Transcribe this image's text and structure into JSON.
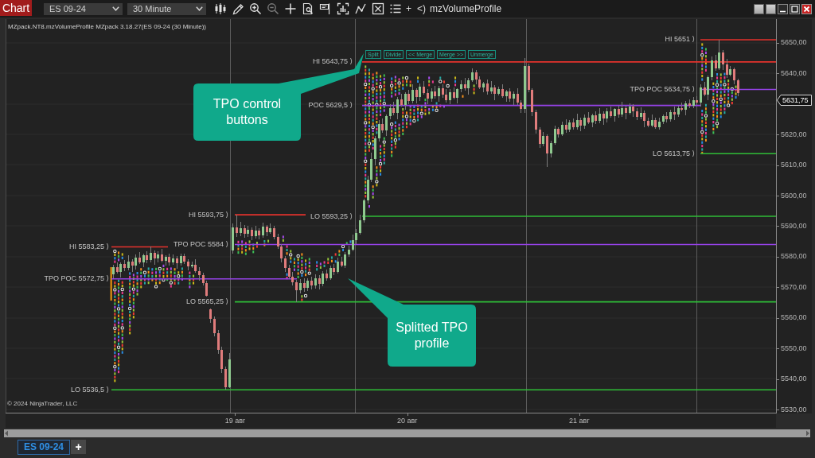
{
  "toolbar": {
    "title": "Chart",
    "instrument": "ES 09-24",
    "interval": "30 Minute",
    "glyphs": [
      "+",
      "<)"
    ],
    "indicator": "mzVolumeProfile"
  },
  "chart": {
    "indicator_label": "MZpack.NT8.mzVolumeProfile MZpack 3.18.27(ES 09-24 (30 Minute))",
    "tpo_buttons": [
      "Split",
      "Divide",
      "<< Merge",
      "Merge >>",
      "Unmerge"
    ],
    "callouts": [
      "TPO control buttons",
      "Splitted TPO profile"
    ],
    "copyright": "© 2024 NinjaTrader, LLC",
    "current_price": "5631,75",
    "chart_data": {
      "type": "candlestick",
      "xlim": [
        17.6656,
        22.143
      ],
      "ylim": [
        5528.75,
        5657.75
      ],
      "yticks": [
        {
          "value": 5650,
          "label": "5650,00"
        },
        {
          "value": 5640,
          "label": "5640,00"
        },
        {
          "value": 5620,
          "label": "5620,00"
        },
        {
          "value": 5610,
          "label": "5610,00"
        },
        {
          "value": 5600,
          "label": "5600,00"
        },
        {
          "value": 5590,
          "label": "5590,00"
        },
        {
          "value": 5580,
          "label": "5580,00"
        },
        {
          "value": 5570,
          "label": "5570,00"
        },
        {
          "value": 5560,
          "label": "5560,00"
        },
        {
          "value": 5550,
          "label": "5550,00"
        },
        {
          "value": 5540,
          "label": "5540,00"
        },
        {
          "value": 5530,
          "label": "5530,00"
        }
      ],
      "xticks": [
        {
          "value": 19,
          "label": "19 авг"
        },
        {
          "value": 20,
          "label": "20 авг"
        },
        {
          "value": 21,
          "label": "21 авг"
        }
      ],
      "ref_lines": [
        {
          "axis": "y",
          "value": 5651,
          "color": "#e5322d",
          "label": "HI 5651 ⟩"
        },
        {
          "axis": "y",
          "value": 5643.75,
          "color": "#e5322d",
          "label": "HI 5643,75 ⟩"
        },
        {
          "axis": "y",
          "value": 5634.75,
          "color": "#9642e8",
          "label": "TPO POC 5634,75 ⟩"
        },
        {
          "axis": "y",
          "value": 5629.5,
          "color": "#9642e8",
          "label": "POC 5629,5 ⟩"
        },
        {
          "axis": "y",
          "value": 5613.75,
          "color": "#2fbd37",
          "label": "LO 5613,75 ⟩"
        },
        {
          "axis": "y",
          "value": 5593.75,
          "color": "#e5322d",
          "label": "HI 5593,75 ⟩"
        },
        {
          "axis": "y",
          "value": 5593.25,
          "color": "#2fbd37",
          "label": "LO 5593,25 ⟩"
        },
        {
          "axis": "y",
          "value": 5583.25,
          "color": "#e5322d",
          "label": "HI 5583,25 ⟩"
        },
        {
          "axis": "y",
          "value": 5584,
          "color": "#9642e8",
          "label": "TPO POC 5584 ⟩"
        },
        {
          "axis": "y",
          "value": 5572.75,
          "color": "#9642e8",
          "label": "TPO POC 5572,75 ⟩"
        },
        {
          "axis": "y",
          "value": 5565.25,
          "color": "#2fbd37",
          "label": "LO 5565,25 ⟩"
        },
        {
          "axis": "y",
          "value": 5536.5,
          "color": "#2fbd37",
          "label": "LO 5536,5 ⟩"
        }
      ],
      "x": [
        18.29,
        18.312,
        18.333,
        18.355,
        18.377,
        18.399,
        18.42,
        18.442,
        18.464,
        18.486,
        18.507,
        18.529,
        18.551,
        18.573,
        18.594,
        18.616,
        18.638,
        18.66,
        18.681,
        18.703,
        18.725,
        18.747,
        18.768,
        18.79,
        18.812,
        18.833,
        18.855,
        18.877,
        18.899,
        18.92,
        18.942,
        18.964,
        18.986,
        19.007,
        19.029,
        19.051,
        19.073,
        19.094,
        19.116,
        19.138,
        19.16,
        19.181,
        19.203,
        19.225,
        19.247,
        19.268,
        19.29,
        19.312,
        19.333,
        19.355,
        19.377,
        19.399,
        19.42,
        19.442,
        19.464,
        19.486,
        19.507,
        19.529,
        19.551,
        19.573,
        19.594,
        19.616,
        19.638,
        19.66,
        19.681,
        19.703,
        19.725,
        19.747,
        19.768,
        19.79,
        19.812,
        19.833,
        19.855,
        19.877,
        19.899,
        19.92,
        19.942,
        19.964,
        19.986,
        20.007,
        20.029,
        20.051,
        20.073,
        20.094,
        20.116,
        20.138,
        20.16,
        20.181,
        20.203,
        20.225,
        20.247,
        20.268,
        20.29,
        20.312,
        20.333,
        20.355,
        20.377,
        20.399,
        20.42,
        20.442,
        20.464,
        20.486,
        20.507,
        20.529,
        20.551,
        20.573,
        20.594,
        20.616,
        20.638,
        20.66,
        20.681,
        20.703,
        20.725,
        20.747,
        20.768,
        20.79,
        20.812,
        20.833,
        20.855,
        20.877,
        20.899,
        20.92,
        20.942,
        20.964,
        20.986,
        21.007,
        21.029,
        21.051,
        21.073,
        21.094,
        21.116,
        21.138,
        21.16,
        21.181,
        21.203,
        21.225,
        21.247,
        21.268,
        21.29,
        21.312,
        21.333,
        21.355,
        21.377,
        21.399,
        21.42,
        21.442,
        21.464,
        21.486,
        21.507,
        21.529,
        21.551,
        21.573,
        21.594,
        21.616,
        21.638,
        21.66,
        21.681,
        21.703,
        21.725,
        21.747,
        21.768,
        21.79,
        21.812,
        21.833,
        21.855,
        21.877,
        21.899,
        21.92
      ],
      "ohlc": [
        [
          5574.25,
          5577.5,
          5573,
          5576.5
        ],
        [
          5576.5,
          5578.25,
          5574.5,
          5575
        ],
        [
          5575,
          5578.25,
          5573.25,
          5577.75
        ],
        [
          5577.75,
          5579,
          5575.25,
          5576.25
        ],
        [
          5576.25,
          5580.5,
          5575.5,
          5578.5
        ],
        [
          5578.5,
          5579.25,
          5575,
          5577
        ],
        [
          5577,
          5580.75,
          5575.75,
          5579.75
        ],
        [
          5579.75,
          5581.5,
          5577.75,
          5578.25
        ],
        [
          5578.25,
          5581,
          5576.5,
          5580.5
        ],
        [
          5580.5,
          5581.75,
          5578,
          5579
        ],
        [
          5579,
          5583.25,
          5578.25,
          5581.25
        ],
        [
          5581.25,
          5582,
          5577.5,
          5579.5
        ],
        [
          5579.5,
          5581.75,
          5578.25,
          5580.75
        ],
        [
          5580.75,
          5582.5,
          5578.25,
          5578.75
        ],
        [
          5578.75,
          5580.5,
          5577,
          5580
        ],
        [
          5580,
          5581,
          5577.25,
          5578.25
        ],
        [
          5578.25,
          5580.75,
          5577.5,
          5579.5
        ],
        [
          5579.5,
          5580.25,
          5576,
          5578
        ],
        [
          5578,
          5581,
          5577.25,
          5580.25
        ],
        [
          5580.25,
          5581,
          5577.75,
          5578.5
        ],
        [
          5578.5,
          5579.25,
          5575.5,
          5576.75
        ],
        [
          5576.75,
          5578.5,
          5576.25,
          5577.5
        ],
        [
          5577.5,
          5579.25,
          5574.75,
          5575.25
        ],
        [
          5575.25,
          5576.5,
          5572.25,
          5574
        ],
        [
          5574,
          5574.75,
          5570.5,
          5571.5
        ],
        [
          5571.5,
          5572.25,
          5567,
          5567.25
        ],
        [
          5562.75,
          5563,
          5558.5,
          5559.75
        ],
        [
          5559.75,
          5560.5,
          5554,
          5555
        ],
        [
          5555,
          5556,
          5548.25,
          5549.5
        ],
        [
          5549.5,
          5550.5,
          5542,
          5543.25
        ],
        [
          5543.25,
          5544,
          5536.5,
          5537.25
        ],
        [
          5537.25,
          5548.5,
          5537,
          5546.5
        ],
        [
          5582,
          5591,
          5581,
          5589.5
        ],
        [
          5589.5,
          5593.75,
          5586.5,
          5587.75
        ],
        [
          5587.75,
          5591.5,
          5586.75,
          5589.25
        ],
        [
          5589.25,
          5590.5,
          5586.25,
          5587.5
        ],
        [
          5587.5,
          5590.25,
          5586.5,
          5588.75
        ],
        [
          5588.75,
          5589.5,
          5585.5,
          5586.75
        ],
        [
          5586.75,
          5590,
          5586,
          5588.5
        ],
        [
          5588.5,
          5589.25,
          5585.75,
          5587
        ],
        [
          5587,
          5591.25,
          5586.25,
          5589.75
        ],
        [
          5589.75,
          5590.5,
          5586.75,
          5588
        ],
        [
          5588,
          5591,
          5587.5,
          5589.25
        ],
        [
          5589.25,
          5590,
          5585.75,
          5586.5
        ],
        [
          5586.5,
          5587.5,
          5582.5,
          5583.25
        ],
        [
          5583.25,
          5584.25,
          5578.25,
          5579.5
        ],
        [
          5579.5,
          5580.25,
          5575,
          5576.25
        ],
        [
          5576.25,
          5577.5,
          5572.75,
          5573.5
        ],
        [
          5573.5,
          5575,
          5570.5,
          5571.75
        ],
        [
          5571.75,
          5572.5,
          5565.25,
          5569
        ],
        [
          5569,
          5572.75,
          5568,
          5571.5
        ],
        [
          5571.5,
          5573,
          5568.5,
          5569.75
        ],
        [
          5569.75,
          5573,
          5568.75,
          5572.25
        ],
        [
          5572.25,
          5573.5,
          5569.25,
          5570.5
        ],
        [
          5570.5,
          5574.25,
          5569.5,
          5573
        ],
        [
          5573,
          5574,
          5569.25,
          5571.25
        ],
        [
          5571.25,
          5575.25,
          5570.25,
          5574.5
        ],
        [
          5574.5,
          5575.75,
          5572.25,
          5573
        ],
        [
          5573,
          5577,
          5572.5,
          5576.25
        ],
        [
          5576.25,
          5577.75,
          5574,
          5575
        ],
        [
          5575,
          5579.75,
          5574.5,
          5578.5
        ],
        [
          5578.5,
          5580,
          5576.5,
          5577.25
        ],
        [
          5577.25,
          5581.5,
          5576.25,
          5580.75
        ],
        [
          5580.75,
          5583.5,
          5580,
          5582.25
        ],
        [
          5582.25,
          5587.25,
          5581.75,
          5585.5
        ],
        [
          5585.5,
          5589,
          5584.25,
          5587.75
        ],
        [
          5587.75,
          5593.75,
          5587.25,
          5592
        ],
        [
          5592,
          5599,
          5591.25,
          5598.5
        ],
        [
          5598.5,
          5606.5,
          5597.5,
          5605.25
        ],
        [
          5605.25,
          5614,
          5604.5,
          5612
        ],
        [
          5612,
          5619.5,
          5610,
          5618.75
        ],
        [
          5618.75,
          5624.75,
          5617.75,
          5623.5
        ],
        [
          5623.5,
          5625.25,
          5620.5,
          5621.25
        ],
        [
          5621.25,
          5626.5,
          5619.5,
          5626
        ],
        [
          5626,
          5630,
          5625,
          5628.75
        ],
        [
          5628.75,
          5630.75,
          5626.25,
          5627
        ],
        [
          5627,
          5632.25,
          5625,
          5631.5
        ],
        [
          5631.5,
          5633.25,
          5629.25,
          5629.75
        ],
        [
          5629.75,
          5633.75,
          5628,
          5633.25
        ],
        [
          5633.25,
          5634.5,
          5630,
          5631
        ],
        [
          5631,
          5636.5,
          5630.25,
          5634.5
        ],
        [
          5634.5,
          5635.25,
          5630.25,
          5632.25
        ],
        [
          5632.25,
          5636.75,
          5631,
          5635.75
        ],
        [
          5635.75,
          5637.5,
          5633,
          5633.5
        ],
        [
          5633.5,
          5634.75,
          5630,
          5631.75
        ],
        [
          5631.75,
          5635.25,
          5630.75,
          5634
        ],
        [
          5634,
          5636,
          5631.75,
          5632.5
        ],
        [
          5632.5,
          5636,
          5630.75,
          5635.25
        ],
        [
          5635.25,
          5636.5,
          5632,
          5633
        ],
        [
          5633,
          5634.75,
          5630.5,
          5631.25
        ],
        [
          5631.25,
          5634.75,
          5630,
          5633.75
        ],
        [
          5633.75,
          5635.5,
          5631.5,
          5632
        ],
        [
          5632,
          5635.25,
          5630.25,
          5634.75
        ],
        [
          5634.75,
          5637.75,
          5633.75,
          5636.5
        ],
        [
          5636.5,
          5638.5,
          5634.25,
          5635
        ],
        [
          5635,
          5638.5,
          5633,
          5637.75
        ],
        [
          5637.75,
          5641.75,
          5637.25,
          5640.25
        ],
        [
          5640.25,
          5641,
          5636.5,
          5638
        ],
        [
          5638,
          5639,
          5634.75,
          5635.5
        ],
        [
          5635.5,
          5637.25,
          5633.75,
          5636.75
        ],
        [
          5636.75,
          5638,
          5633,
          5634
        ],
        [
          5634,
          5637.5,
          5633.25,
          5635.5
        ],
        [
          5635.5,
          5636.25,
          5631.25,
          5633.25
        ],
        [
          5633.25,
          5635.75,
          5632.75,
          5634.75
        ],
        [
          5634.75,
          5636.5,
          5632,
          5632.5
        ],
        [
          5632.5,
          5634.5,
          5630.75,
          5634
        ],
        [
          5634,
          5635.25,
          5630.75,
          5631.75
        ],
        [
          5631.75,
          5634,
          5629.75,
          5633.25
        ],
        [
          5633.25,
          5635.25,
          5629.75,
          5630.5
        ],
        [
          5630.5,
          5631.25,
          5627,
          5628.25
        ],
        [
          5628.25,
          5645,
          5627,
          5642.5
        ],
        [
          5642.5,
          5643.25,
          5633.75,
          5634.5
        ],
        [
          5634.5,
          5635.25,
          5626,
          5627.25
        ],
        [
          5627.25,
          5628,
          5620.25,
          5621.5
        ],
        [
          5621.5,
          5622.25,
          5615.5,
          5617
        ],
        [
          5617,
          5620.75,
          5616.25,
          5619.5
        ],
        [
          5619.5,
          5620,
          5609.5,
          5613.75
        ],
        [
          5613.75,
          5618,
          5612.5,
          5617.25
        ],
        [
          5617.25,
          5623,
          5616.75,
          5621.75
        ],
        [
          5621.75,
          5622.5,
          5619,
          5620
        ],
        [
          5620,
          5624.25,
          5619.5,
          5623.25
        ],
        [
          5623.25,
          5625,
          5620.5,
          5621.5
        ],
        [
          5621.5,
          5624.75,
          5620.75,
          5624
        ],
        [
          5624,
          5625.25,
          5621.5,
          5622.25
        ],
        [
          5622.25,
          5626.75,
          5621.5,
          5624.75
        ],
        [
          5624.75,
          5625.5,
          5621,
          5623
        ],
        [
          5623,
          5626.5,
          5621.75,
          5625.5
        ],
        [
          5625.5,
          5627.25,
          5623.5,
          5624
        ],
        [
          5624,
          5626.75,
          5622.25,
          5626.25
        ],
        [
          5626.25,
          5627.5,
          5623.5,
          5624.5
        ],
        [
          5624.5,
          5628.75,
          5623.75,
          5626.75
        ],
        [
          5626.75,
          5627.5,
          5623.25,
          5625.25
        ],
        [
          5625.25,
          5628.5,
          5624,
          5627.5
        ],
        [
          5627.5,
          5629.25,
          5625.5,
          5626
        ],
        [
          5626,
          5628.75,
          5624.25,
          5628.25
        ],
        [
          5628.25,
          5629.5,
          5625.5,
          5626.5
        ],
        [
          5626.5,
          5630.75,
          5625.75,
          5628.75
        ],
        [
          5628.75,
          5629.5,
          5625,
          5627
        ],
        [
          5627,
          5630.25,
          5626.5,
          5629.25
        ],
        [
          5629.25,
          5630,
          5625.75,
          5627.5
        ],
        [
          5627.5,
          5628.75,
          5624.75,
          5625.75
        ],
        [
          5625.75,
          5629,
          5625,
          5627
        ],
        [
          5627,
          5627.75,
          5622.5,
          5624.5
        ],
        [
          5624.5,
          5625.5,
          5622.5,
          5623
        ],
        [
          5623,
          5626.5,
          5622.25,
          5624.75
        ],
        [
          5624.75,
          5625.5,
          5621.75,
          5622.5
        ],
        [
          5622.5,
          5625.5,
          5621.5,
          5624.25
        ],
        [
          5624.25,
          5626.5,
          5623.5,
          5626
        ],
        [
          5626,
          5627.25,
          5624,
          5625
        ],
        [
          5625,
          5628,
          5624.25,
          5627.25
        ],
        [
          5627.25,
          5629.25,
          5624.75,
          5626.5
        ],
        [
          5626.5,
          5629.5,
          5625.75,
          5628.75
        ],
        [
          5628.75,
          5630.5,
          5627.5,
          5628
        ],
        [
          5628,
          5631,
          5626.25,
          5630.25
        ],
        [
          5630.25,
          5631.5,
          5628.5,
          5629.5
        ],
        [
          5629.5,
          5632.25,
          5628.75,
          5631.25
        ],
        [
          5631.25,
          5632.5,
          5629.75,
          5630.5
        ],
        [
          5630.5,
          5636.5,
          5629.25,
          5635.5
        ],
        [
          5635.5,
          5637.25,
          5632.5,
          5633
        ],
        [
          5633,
          5639.25,
          5631.25,
          5638.75
        ],
        [
          5638.75,
          5645.5,
          5637.75,
          5644.25
        ],
        [
          5644.25,
          5646,
          5640.75,
          5641.5
        ],
        [
          5641.5,
          5651,
          5641,
          5646.75
        ],
        [
          5646.75,
          5647.5,
          5641,
          5643
        ],
        [
          5643,
          5644.75,
          5638.5,
          5639.5
        ],
        [
          5639.5,
          5642.5,
          5639,
          5641.25
        ],
        [
          5641.25,
          5642,
          5636.5,
          5637.75
        ],
        [
          5637.75,
          5638.25,
          5632.5,
          5633.5
        ]
      ]
    }
  },
  "tabs": [
    {
      "label": "ES 09-24",
      "selected": true
    }
  ],
  "add_tab": "+"
}
